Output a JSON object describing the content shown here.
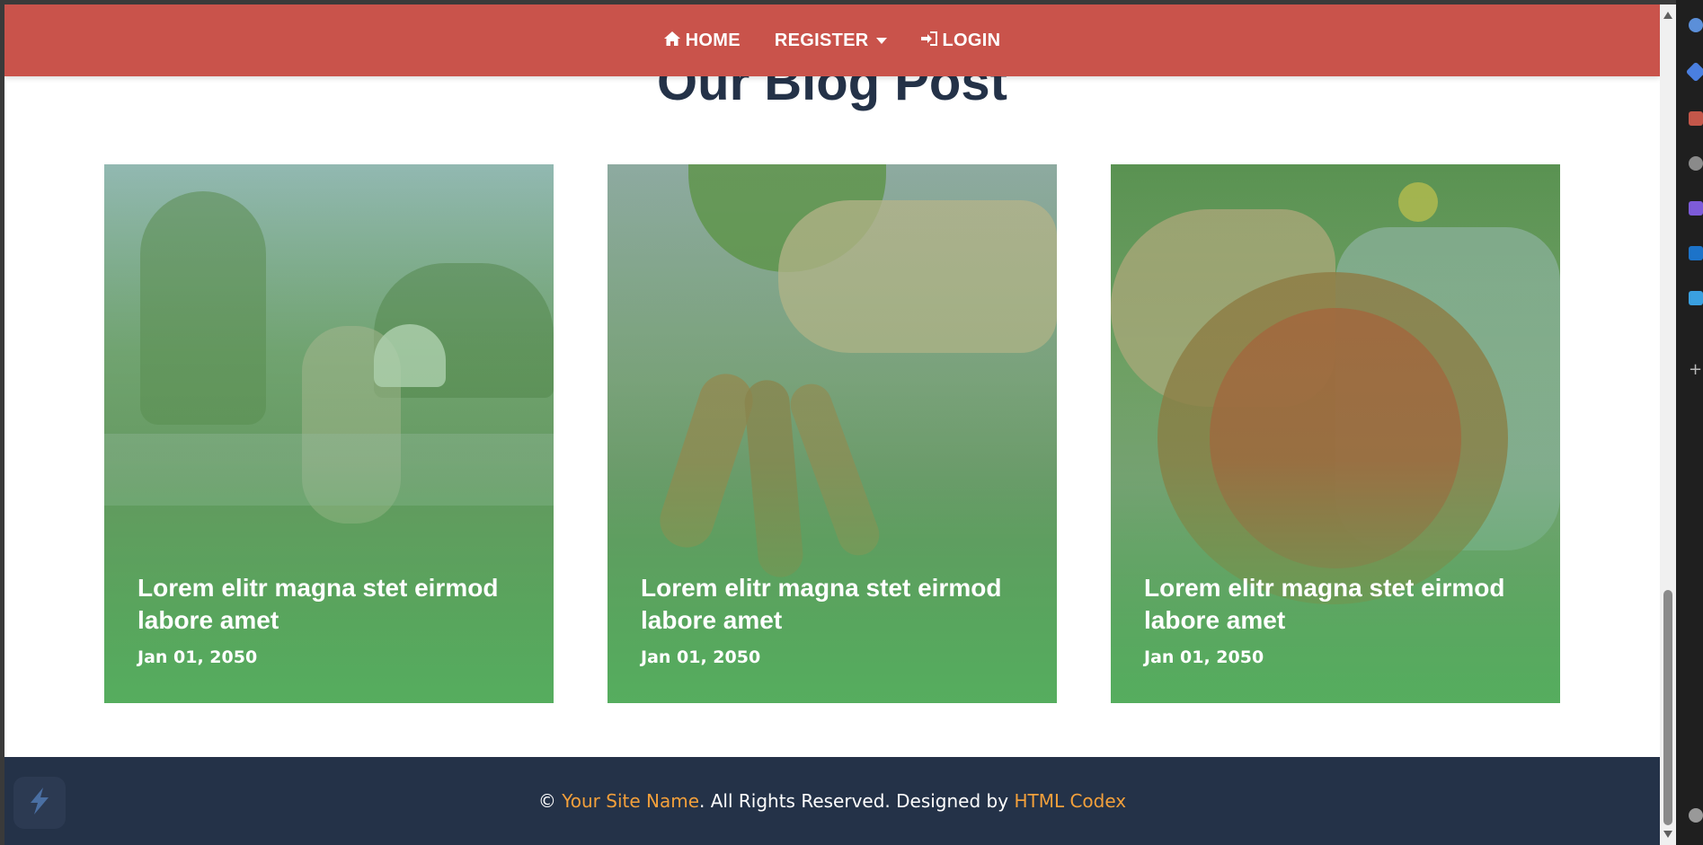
{
  "nav": {
    "home": "HOME",
    "register": "REGISTER",
    "login": "LOGIN"
  },
  "section": {
    "title": "Our Blog Post"
  },
  "posts": [
    {
      "title": "Lorem elitr magna stet eirmod labore amet",
      "date": "Jan 01, 2050"
    },
    {
      "title": "Lorem elitr magna stet eirmod labore amet",
      "date": "Jan 01, 2050"
    },
    {
      "title": "Lorem elitr magna stet eirmod labore amet",
      "date": "Jan 01, 2050"
    }
  ],
  "footer": {
    "copyright_symbol": "©",
    "site_name": "Your Site Name",
    "rights_text": ". All Rights Reserved. Designed by",
    "designer": "HTML Codex"
  },
  "colors": {
    "navbar": "#c9534b",
    "title": "#243248",
    "footer_bg": "#243248",
    "footer_link": "#f3a03b",
    "card_overlay": "#55af5f"
  },
  "icons": {
    "home": "home-icon",
    "login": "sign-in-icon",
    "register_caret": "caret-down-icon",
    "widget": "lightning-icon"
  }
}
